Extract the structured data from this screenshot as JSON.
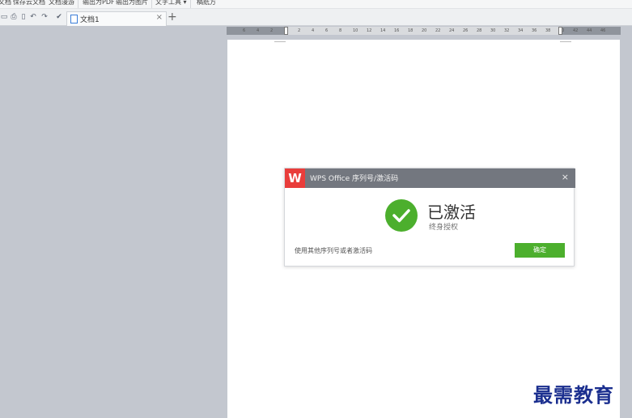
{
  "menubar": {
    "items": [
      "文档",
      "保存云文档",
      "文档漫游",
      "输出为PDF",
      "输出为图片",
      "文字工具 ▾",
      "稿纸方"
    ]
  },
  "tabbar": {
    "tab_label": "文档1",
    "close_glyph": "×",
    "new_tab_glyph": "+"
  },
  "ruler": {
    "ticks": [
      "6",
      "4",
      "2",
      "",
      "2",
      "4",
      "6",
      "8",
      "10",
      "12",
      "14",
      "16",
      "18",
      "20",
      "22",
      "24",
      "26",
      "28",
      "30",
      "32",
      "34",
      "36",
      "38",
      "40",
      "42",
      "44",
      "46"
    ]
  },
  "dialog": {
    "logo_glyph": "W",
    "title": "WPS Office 序列号/激活码",
    "close_glyph": "×",
    "status": "已激活",
    "substatus": "终身授权",
    "alt_link": "使用其他序列号或者激活码",
    "confirm_label": "确定"
  },
  "watermark": "最需教育",
  "colors": {
    "accent_green": "#4caf2d",
    "logo_red": "#e93d3b",
    "header_gray": "#73777f",
    "watermark_blue": "#1b2f8f"
  }
}
